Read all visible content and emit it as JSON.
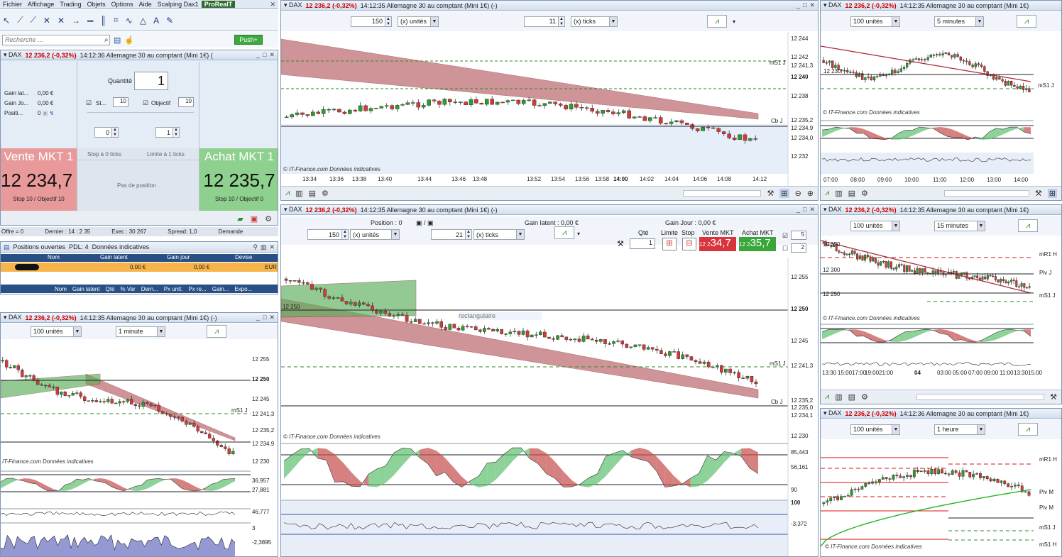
{
  "menu": {
    "items": [
      "Fichier",
      "Affichage",
      "Trading",
      "Objets",
      "Options",
      "Aide",
      "Scalping Dax1",
      "ProRealT"
    ]
  },
  "search": {
    "placeholder": "Recherche ...",
    "push_label": "Push+"
  },
  "order_ticket": {
    "header": "▾ DAX",
    "header_price": "12 236,2 (-0,32%)",
    "header_info": "14:12:36 Allemagne 30 au comptant (Mini 1€) (",
    "quantity_label": "Quantité",
    "quantity_value": "1",
    "gain_latent_label": "Gain lat...",
    "gain_latent_value": "0,00 €",
    "gain_jour_label": "Gain Jo...",
    "gain_jour_value": "0,00 €",
    "position_label": "Positi...",
    "position_value": "0",
    "stop_label": "St...",
    "stop_value": "10",
    "objectif_label": "Objectif",
    "objectif_value": "10",
    "spin_left": "0",
    "spin_right": "1",
    "vente_label": "Vente MKT 1",
    "vente_price": "12 234,7",
    "vente_sub": "Stop 10 / Objectif 10",
    "stop_at": "Stop à 0 ticks",
    "limit_at": "Limite à 1 ticks",
    "no_position": "Pas de position",
    "achat_label": "Achat MKT 1",
    "achat_price": "12 235,7",
    "achat_sub": "Stop 10 / Objectif 0"
  },
  "market_depth": {
    "offre": "Offre = 0",
    "dernier": "Dernier : 14 : 2 35",
    "exec": "Exec : 30 267",
    "spread": "Spread: 1,0",
    "demande": "Demande"
  },
  "positions": {
    "title": "Positions ouvertes",
    "count": "PDL: 4",
    "data_label": "Données indicatives",
    "cols": [
      "Nom",
      "Gain latent",
      "Gain jour",
      "Devise"
    ],
    "row": [
      "",
      "0,00 €",
      "0,00 €",
      "EUR"
    ],
    "sub_cols": [
      "Nom",
      "Gain latent",
      "Qté",
      "% Var",
      "Dern...",
      "Px unit.",
      "Px re...",
      "Gain...",
      "Expo..."
    ]
  },
  "chart_tl": {
    "title": "▾ DAX",
    "price": "12 236,2 (-0,32%)",
    "info": "14:12:35 Allemagne 30 au comptant (Mini 1€) (-)",
    "units": "100 unités",
    "tf": "1 minute",
    "y": [
      "12 255",
      "12 250",
      "12 245",
      "12 241,3",
      "12 235,2",
      "12 234,9",
      "12 230",
      "36,957",
      "27,881",
      "46,777",
      "3",
      "-2,3895"
    ],
    "tag_ms1": "mS1 J",
    "watermark": "IT-Finance.com  Données indicatives"
  },
  "chart_main_top": {
    "title": "▾ DAX",
    "price": "12 236,2 (-0,32%)",
    "info": "14:12:35 Allemagne 30 au comptant (Mini 1€) (-)",
    "spin1": "150",
    "spin1_unit": "(x) unités",
    "spin2": "11",
    "spin2_unit": "(x) ticks",
    "y": [
      "12 244",
      "12 242",
      "12 241,3",
      "12 240",
      "12 238",
      "12 235,2",
      "12 234,9",
      "12 234,0",
      "12 232"
    ],
    "x": [
      "13:34",
      "13:36",
      "13:38",
      "13:40",
      "13:44",
      "13:46",
      "13:48",
      "13:52",
      "13:54",
      "13:56",
      "13:58",
      "14:00",
      "14:02",
      "14:04",
      "14:06",
      "14:08",
      "14:12"
    ],
    "tag_ms1": "mS1 J",
    "tag_cb": "Cb J",
    "watermark": "© IT-Finance.com  Données indicatives"
  },
  "chart_main": {
    "title": "▾ DAX",
    "price": "12 236,2 (-0,32%)",
    "info": "14:12:35 Allemagne 30 au comptant (Mini 1€) (-)",
    "position": "Position : 0",
    "gain_latent": "Gain latent : 0,00 €",
    "gain_jour": "Gain Jour : 0,00 €",
    "spin1": "150",
    "spin1_unit": "(x) unités",
    "spin2": "21",
    "spin2_unit": "(x) ticks",
    "qty_label": "Qté",
    "qty": "1",
    "limit_label": "Limite",
    "stop_label": "Stop",
    "vente_label": "Vente MKT",
    "achat_label": "Achat MKT",
    "vente_price": "34,7",
    "vente_prefix": "12 2",
    "achat_price": "35,7",
    "achat_prefix": "12 2",
    "side_top": "5",
    "side_bot": "2",
    "y": [
      "12 255",
      "12 250",
      "12 245",
      "12 241,3",
      "12 235,2",
      "12 235,0",
      "12 234,1",
      "12 230",
      "85,443",
      "56,161",
      "90",
      "100",
      "-3,372"
    ],
    "tag_ms1": "mS1 J",
    "tag_cb": "Cb J",
    "overlay_label": "rectangulaire",
    "watermark": "© IT-Finance.com  Données indicatives"
  },
  "chart_rt": {
    "title": "▾ DAX",
    "price": "12 236,2 (-0,32%)",
    "info": "14:12:35 Allemagne 30 au comptant (Mini 1€)",
    "units": "100 unités",
    "tf": "5 minutes",
    "x": [
      "07:00",
      "08:00",
      "09:00",
      "10:00",
      "11:00",
      "12:00",
      "13:00",
      "14:00"
    ],
    "y_mid": "12 230",
    "tag_ms1": "mS1 J",
    "watermark": "© IT-Finance.com  Données indicatives"
  },
  "chart_rm": {
    "title": "▾ DAX",
    "price": "12 236,2 (-0,32%)",
    "info": "14:12:35 Allemagne 30 au comptant (Mini 1€)",
    "units": "100 unités",
    "tf": "15 minutes",
    "y": [
      "12 350",
      "12 300",
      "12 250"
    ],
    "x": [
      "13:30",
      "15:00",
      "17:00",
      "19:00",
      "21:00",
      "04",
      "03:00",
      "05:00",
      "07:00",
      "09:00",
      "11:00",
      "13:30",
      "15:00"
    ],
    "tags": [
      "mR1 H",
      "Piv J",
      "mS1 J"
    ],
    "watermark": "© IT-Finance.com  Données indicatives"
  },
  "chart_rb": {
    "title": "▾ DAX",
    "price": "12 236,2 (-0,32%)",
    "info": "14:12:36 Allemagne 30 au comptant (Mini 1€)",
    "units": "100 unités",
    "tf": "1 heure",
    "tags": [
      "mR1 H",
      "Piv M",
      "Piv M",
      "mS1 J",
      "mS1 H"
    ],
    "watermark": "© IT-Finance.com  Données indicatives"
  },
  "colors": {
    "up": "#2e9b2e",
    "down": "#d23a3a",
    "band_red": "#b54a4e",
    "band_green": "#4aa84a"
  }
}
